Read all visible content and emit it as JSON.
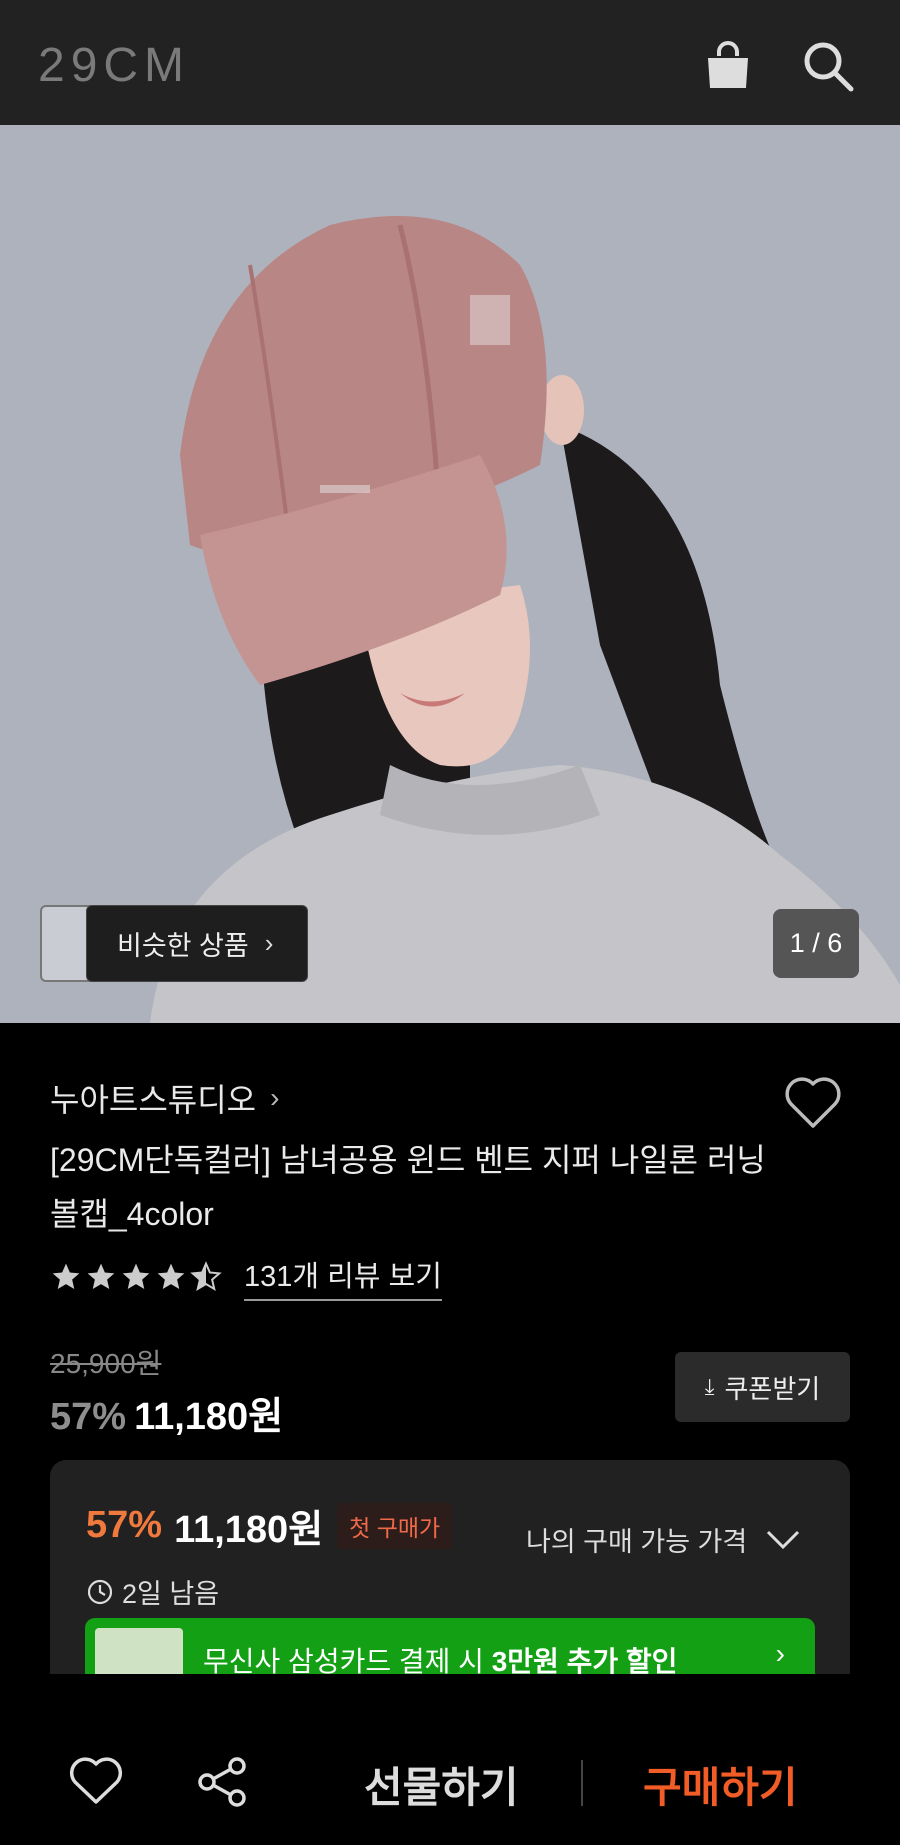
{
  "header": {
    "logo": "29CM",
    "icons": [
      "shopping-bag-icon",
      "search-icon"
    ]
  },
  "gallery": {
    "similar_label": "비슷한 상품",
    "counter": "1 / 6"
  },
  "product": {
    "brand": "누아트스튜디오",
    "title": "[29CM단독컬러] 남녀공용 윈드 벤트 지퍼 나일론 러닝 볼캡_4color",
    "rating_stars": 4.5,
    "review_link": "131개 리뷰 보기",
    "original_price": "25,900원",
    "discount_rate": "57%",
    "sale_price": "11,180원",
    "coupon_button": "쿠폰받기"
  },
  "best_price": {
    "discount_rate": "57%",
    "price": "11,180원",
    "badge": "첫 구매가",
    "my_price_label": "나의 구매 가능 가격",
    "time_left": "2일 남음",
    "promo_prefix": "무신사 삼성카드 결제 시",
    "promo_bold": "3만원 추가 할인",
    "promo_color": "#13a015"
  },
  "bottom_bar": {
    "gift_label": "선물하기",
    "buy_label": "구매하기",
    "buy_color": "#f25c26"
  }
}
